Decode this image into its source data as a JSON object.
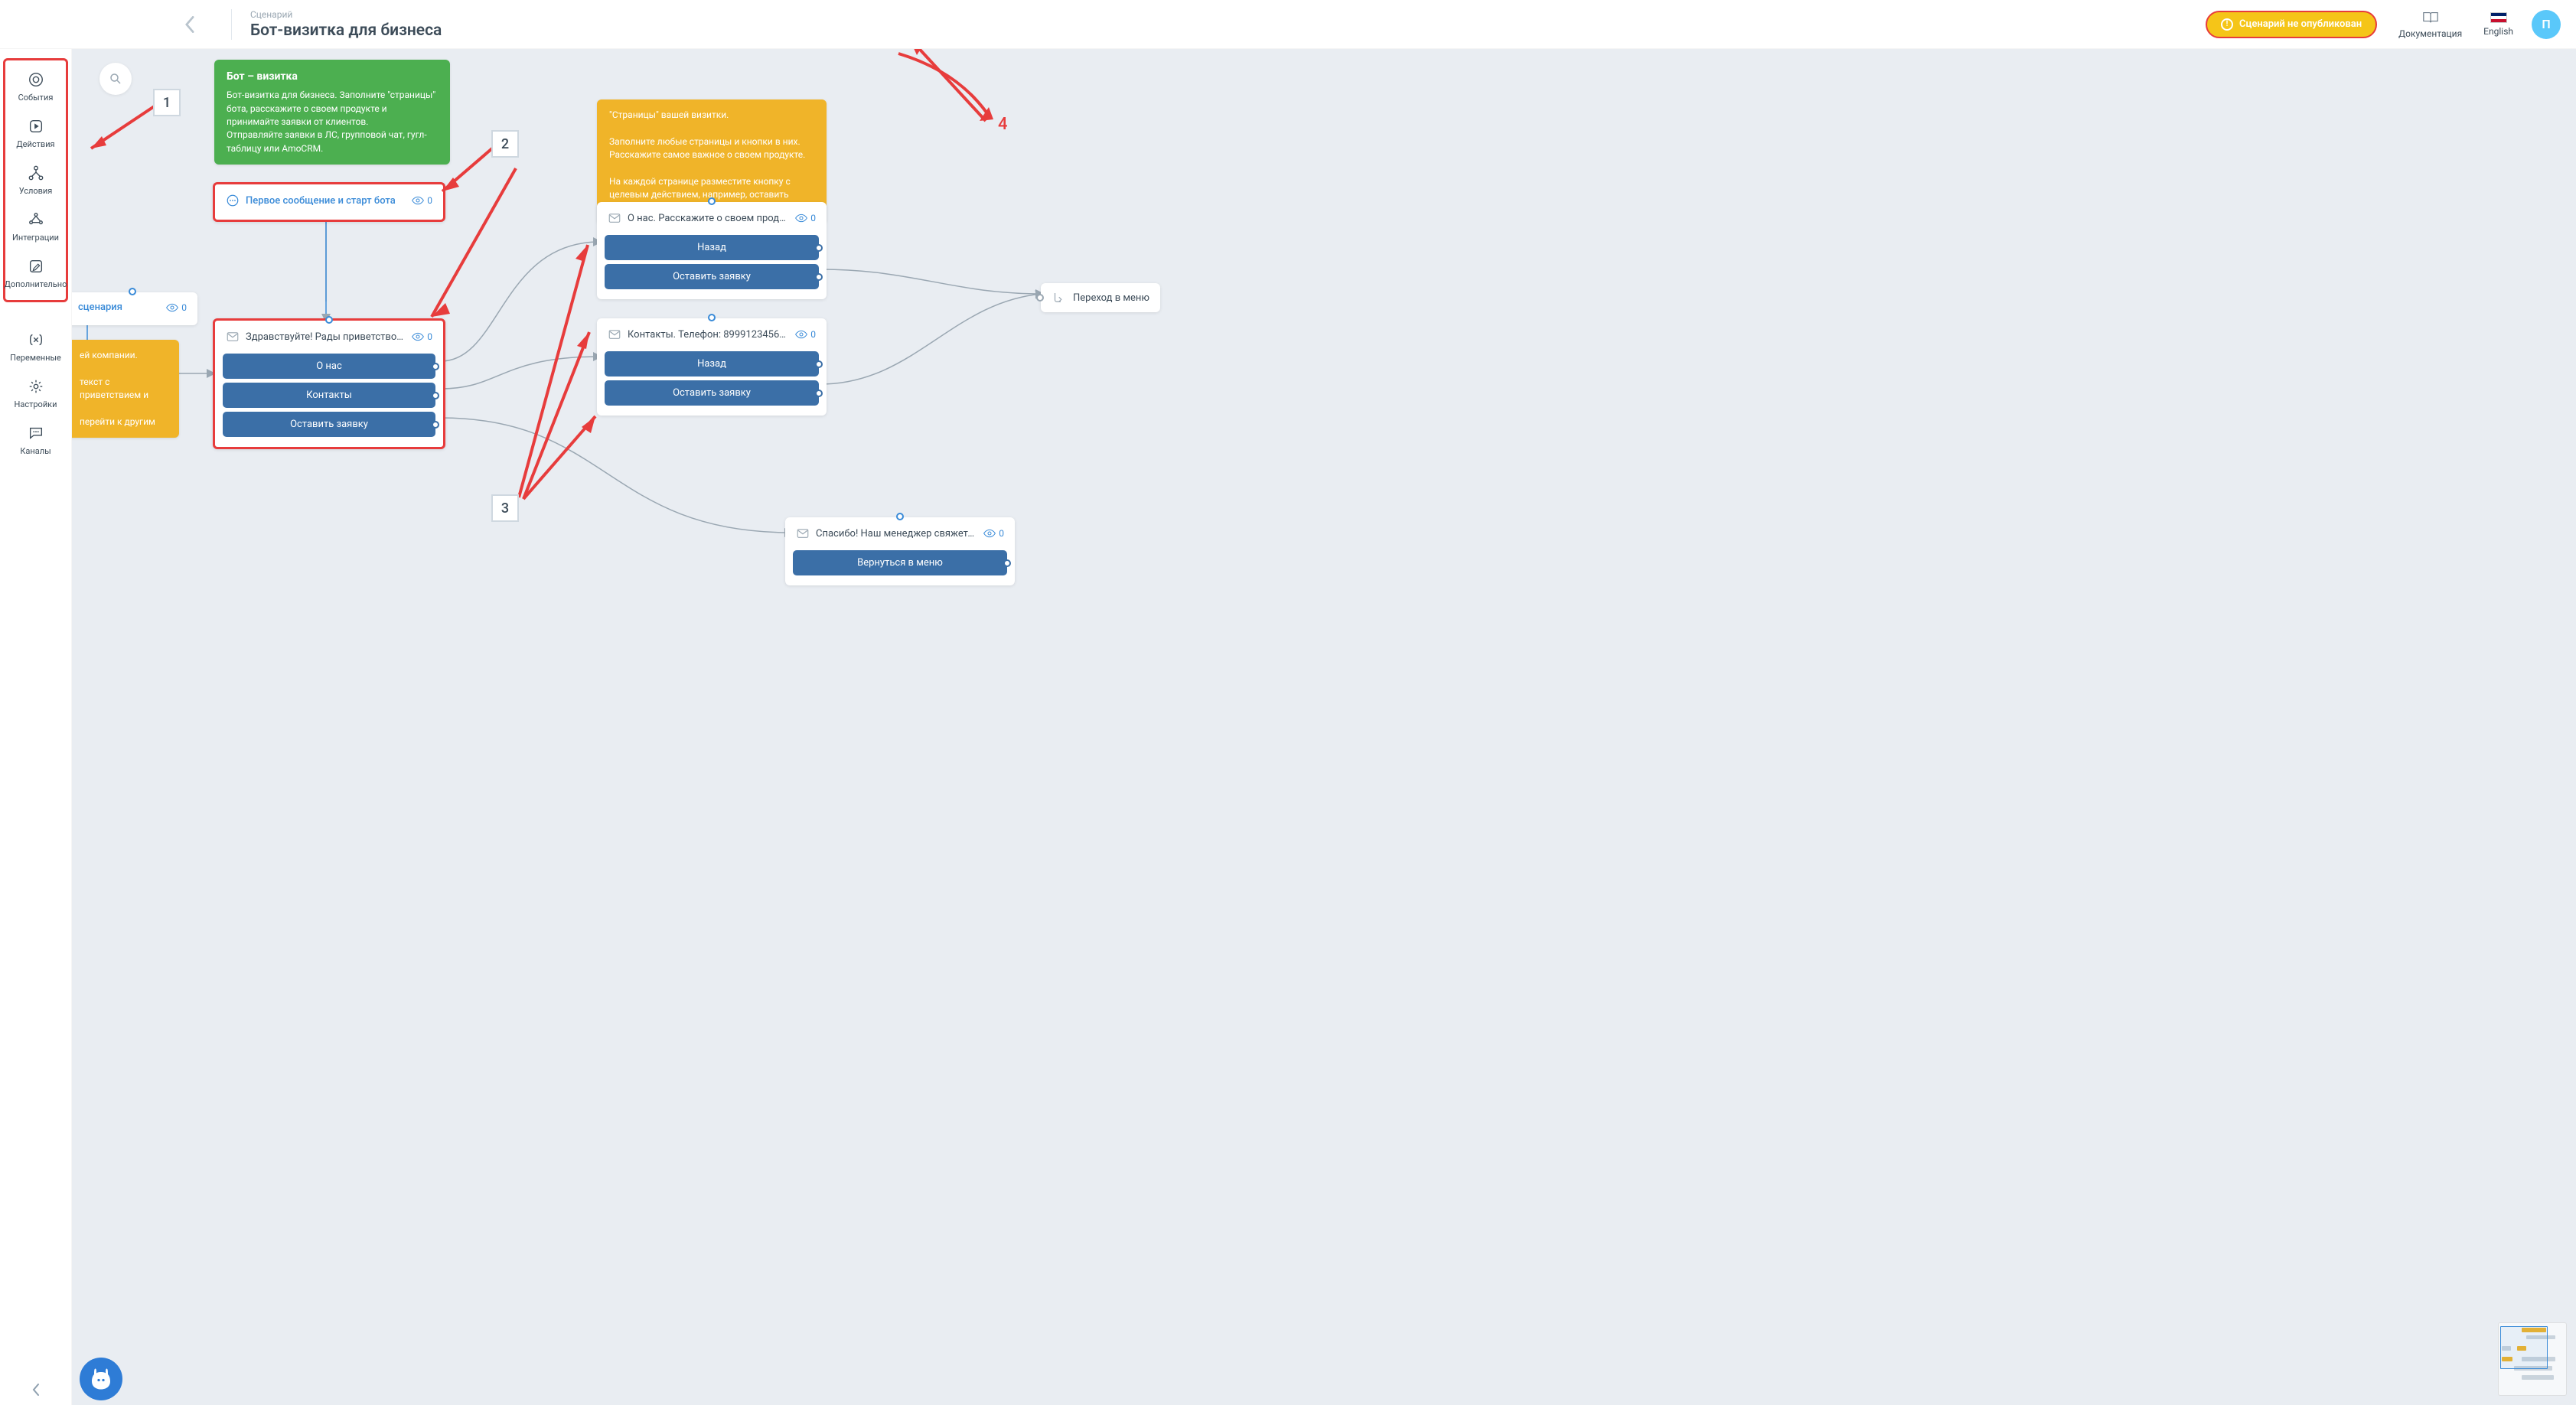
{
  "header": {
    "breadcrumb": "Сценарий",
    "title": "Бот-визитка для бизнеса",
    "publish_badge": "Сценарий не опубликован",
    "docs": "Документация",
    "lang": "English",
    "avatar_letter": "П"
  },
  "sidebar": {
    "group": [
      {
        "label": "События"
      },
      {
        "label": "Действия"
      },
      {
        "label": "Условия"
      },
      {
        "label": "Интеграции"
      },
      {
        "label": "Дополнительно"
      }
    ],
    "rest": [
      {
        "label": "Переменные"
      },
      {
        "label": "Настройки"
      },
      {
        "label": "Каналы"
      }
    ]
  },
  "notes": {
    "green": {
      "title": "Бот – визитка",
      "body": "Бот-визитка для бизнеса. Заполните \"страницы\" бота, расскажите о своем продукте и принимайте заявки от клиентов.\nОтправляйте заявки в ЛС, групповой чат, гугл-таблицу или AmoCRM."
    },
    "yellow_tips": "\"Страницы\" вашей визитки.\n\nЗаполните любые страницы и кнопки в них. Расскажите самое важное о своем продукте.\n\nНа каждой странице разместите кнопку с целевым действием, например, оставить заявку",
    "yellow_left": "ей компании.\n\nтекст с приветствием и\n\nперейти к другим"
  },
  "blocks": {
    "scenario_edge": {
      "label": "сценария",
      "count": "0"
    },
    "start": {
      "label": "Первое сообщение и старт бота",
      "count": "0"
    },
    "welcome": {
      "label": "Здравствуйте! Рады приветствовать вас в …",
      "count": "0",
      "buttons": [
        "О нас",
        "Контакты",
        "Оставить заявку"
      ]
    },
    "about": {
      "label": "О нас. Расскажите о своем продукте. Вы м…",
      "count": "0",
      "buttons": [
        "Назад",
        "Оставить заявку"
      ]
    },
    "contacts": {
      "label": "Контакты. Телефон: 89991234567 Наш адр…",
      "count": "0",
      "buttons": [
        "Назад",
        "Оставить заявку"
      ]
    },
    "thanks": {
      "label": "Спасибо! Наш менеджер свяжется с вами в…",
      "count": "0",
      "buttons": [
        "Вернуться в меню"
      ]
    },
    "goto": {
      "label": "Переход в меню"
    }
  },
  "annotations": {
    "n1": "1",
    "n2": "2",
    "n3": "3",
    "n4": "4"
  }
}
